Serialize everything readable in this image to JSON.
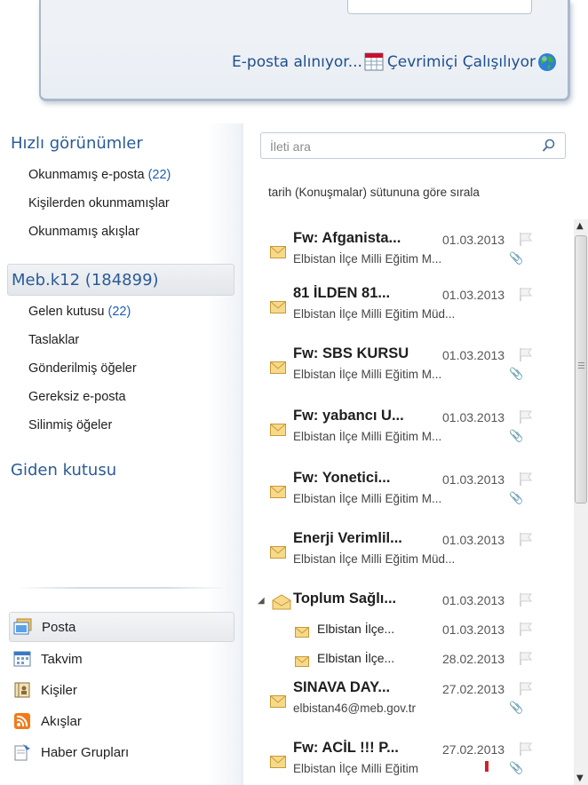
{
  "status_bar": {
    "receiving_text": "E-posta alınıyor...",
    "online_text": "Çevrimiçi Çalışılıyor",
    "progress_icon": "table-progress-icon",
    "online_icon": "globe-icon"
  },
  "sidebar": {
    "quick_views": {
      "title": "Hızlı görünümler",
      "items": [
        {
          "label": "Okunmamış e-posta",
          "count": "(22)"
        },
        {
          "label": "Kişilerden okunmamışlar",
          "count": ""
        },
        {
          "label": "Okunmamış akışlar",
          "count": ""
        }
      ]
    },
    "account": {
      "title": "Meb.k12 (184899)",
      "folders": [
        {
          "label": "Gelen kutusu",
          "count": "(22)"
        },
        {
          "label": "Taslaklar",
          "count": ""
        },
        {
          "label": "Gönderilmiş öğeler",
          "count": ""
        },
        {
          "label": "Gereksiz e-posta",
          "count": ""
        },
        {
          "label": "Silinmiş öğeler",
          "count": ""
        }
      ]
    },
    "outbox": {
      "title": "Giden kutusu"
    },
    "apps": [
      {
        "label": "Posta",
        "icon": "mail-app-icon",
        "active": true
      },
      {
        "label": "Takvim",
        "icon": "calendar-icon",
        "active": false
      },
      {
        "label": "Kişiler",
        "icon": "contacts-icon",
        "active": false
      },
      {
        "label": "Akışlar",
        "icon": "rss-feed-icon",
        "active": false
      },
      {
        "label": "Haber Grupları",
        "icon": "newsgroups-icon",
        "active": false
      }
    ]
  },
  "message_list": {
    "search_placeholder": "İleti ara",
    "sort_text": "tarih (Konuşmalar) sütununa göre sırala",
    "messages": [
      {
        "subject": "Fw: Afganista...",
        "date": "01.03.2013",
        "from": "Elbistan İlçe Milli Eğitim M...",
        "attachment": true
      },
      {
        "subject": "81 İLDEN 81...",
        "date": "01.03.2013",
        "from": "Elbistan İlçe Milli Eğitim Müd...",
        "attachment": false
      },
      {
        "subject": "Fw: SBS KURSU",
        "date": "01.03.2013",
        "from": "Elbistan İlçe Milli Eğitim M...",
        "attachment": true
      },
      {
        "subject": "Fw: yabancı U...",
        "date": "01.03.2013",
        "from": "Elbistan İlçe Milli Eğitim M...",
        "attachment": true
      },
      {
        "subject": "Fw: Yonetici...",
        "date": "01.03.2013",
        "from": "Elbistan İlçe Milli Eğitim M...",
        "attachment": true
      },
      {
        "subject": "Enerji Verimlil...",
        "date": "01.03.2013",
        "from": "Elbistan İlçe Milli Eğitim Müd...",
        "attachment": false
      }
    ],
    "conversation": {
      "subject": "Toplum Sağlı...",
      "date": "01.03.2013",
      "children": [
        {
          "subject": "Elbistan İlçe...",
          "date": "01.03.2013"
        },
        {
          "subject": "Elbistan İlçe...",
          "date": "28.02.2013"
        }
      ]
    },
    "more_messages": [
      {
        "subject": "SINAVA DAY...",
        "date": "27.02.2013",
        "from": "elbistan46@meb.gov.tr",
        "attachment": true,
        "important": false
      },
      {
        "subject": "Fw: ACİL !!! P...",
        "date": "27.02.2013",
        "from": "Elbistan İlçe Milli Eğitim",
        "attachment": true,
        "important": true
      }
    ]
  }
}
